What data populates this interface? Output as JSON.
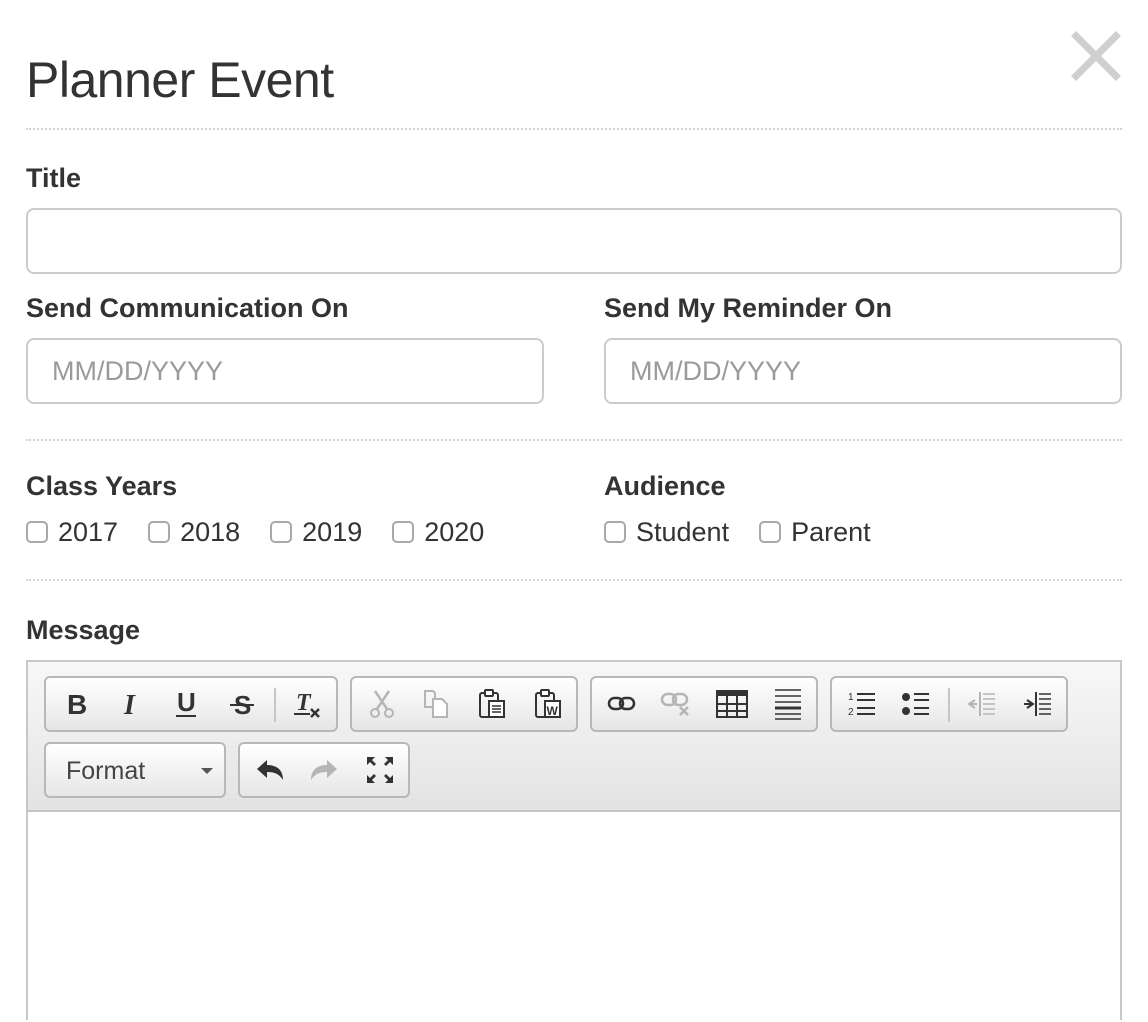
{
  "modal": {
    "title": "Planner Event",
    "close_icon": "close-icon"
  },
  "form": {
    "title_label": "Title",
    "title_value": "",
    "send_communication_label": "Send Communication On",
    "send_communication_placeholder": "MM/DD/YYYY",
    "reminder_label": "Send My Reminder On",
    "reminder_placeholder": "MM/DD/YYYY",
    "class_years_label": "Class Years",
    "class_years": [
      {
        "label": "2017",
        "checked": false
      },
      {
        "label": "2018",
        "checked": false
      },
      {
        "label": "2019",
        "checked": false
      },
      {
        "label": "2020",
        "checked": false
      }
    ],
    "audience_label": "Audience",
    "audience": [
      {
        "label": "Student",
        "checked": false
      },
      {
        "label": "Parent",
        "checked": false
      }
    ],
    "message_label": "Message"
  },
  "editor": {
    "toolbar_groups": [
      [
        "bold-icon",
        "italic-icon",
        "underline-icon",
        "strikethrough-icon",
        "remove-format-icon"
      ],
      [
        "cut-icon",
        "copy-icon",
        "paste-icon",
        "paste-from-word-icon"
      ],
      [
        "link-icon",
        "unlink-icon",
        "table-icon",
        "horizontal-rule-icon"
      ],
      [
        "numbered-list-icon",
        "bulleted-list-icon",
        "outdent-icon",
        "indent-icon"
      ],
      [
        "undo-icon",
        "redo-icon",
        "maximize-icon"
      ]
    ],
    "format_label": "Format",
    "body": ""
  },
  "colors": {
    "text": "#333333",
    "placeholder": "#9a9a9a",
    "border": "#cccccc",
    "close_icon": "#cfcfcf",
    "toolbar_icon": "#333333",
    "toolbar_icon_disabled": "#b5b5b5"
  }
}
